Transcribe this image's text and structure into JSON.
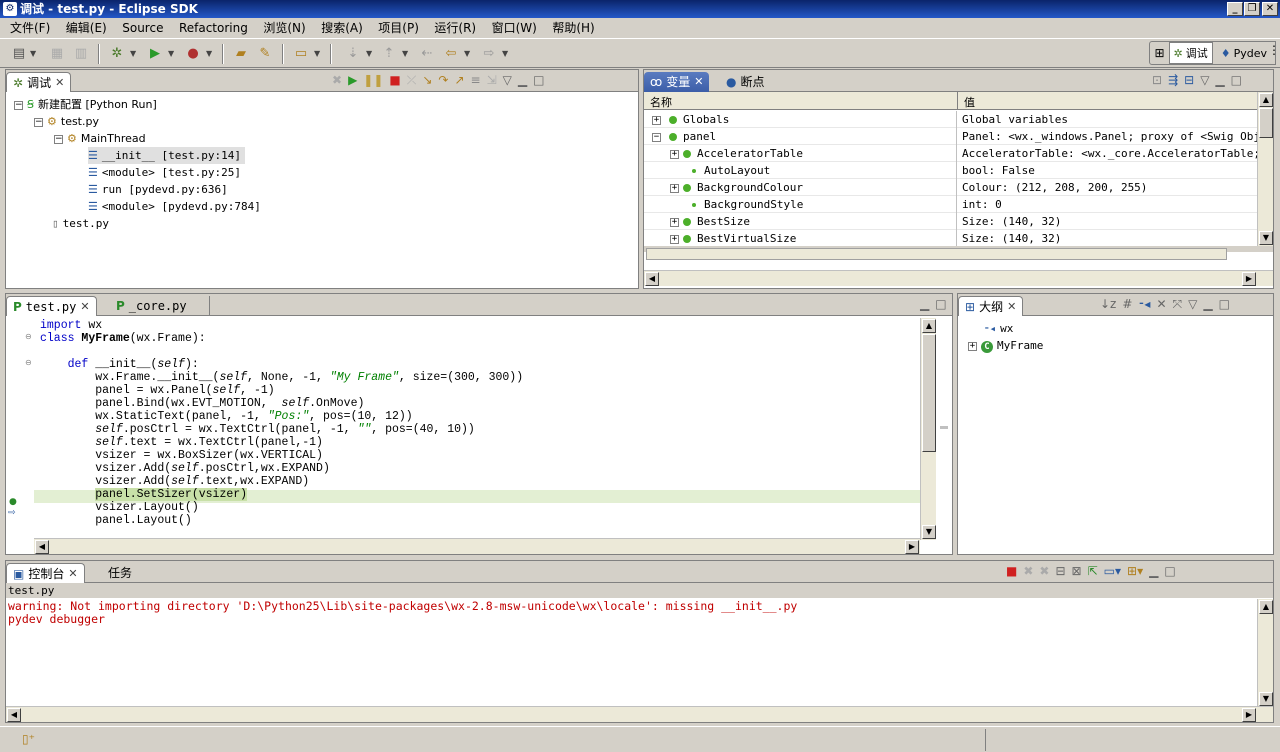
{
  "window": {
    "title": "调试 - test.py - Eclipse SDK"
  },
  "menu": [
    "文件(F)",
    "编辑(E)",
    "Source",
    "Refactoring",
    "浏览(N)",
    "搜索(A)",
    "项目(P)",
    "运行(R)",
    "窗口(W)",
    "帮助(H)"
  ],
  "perspectives": [
    {
      "label": "调试",
      "active": true
    },
    {
      "label": "Pydev",
      "active": false
    }
  ],
  "debug_view": {
    "tab": "调试",
    "tree": [
      {
        "label": "新建配置 [Python Run]",
        "level": 0
      },
      {
        "label": "test.py",
        "level": 1
      },
      {
        "label": "MainThread",
        "level": 2
      },
      {
        "label": "__init__ [test.py:14]",
        "level": 3,
        "selected": true
      },
      {
        "label": "<module> [test.py:25]",
        "level": 3
      },
      {
        "label": "run [pydevd.py:636]",
        "level": 3
      },
      {
        "label": "<module> [pydevd.py:784]",
        "level": 3
      },
      {
        "label": "test.py",
        "level": 1
      }
    ]
  },
  "variables_view": {
    "tabs": [
      "变量",
      "断点"
    ],
    "columns": [
      "名称",
      "值"
    ],
    "rows": [
      {
        "name": "Globals",
        "value": "Global variables",
        "level": 0,
        "expander": "+"
      },
      {
        "name": "panel",
        "value": "Panel: <wx._windows.Panel; proxy of <Swig Object.",
        "level": 0,
        "expander": "-"
      },
      {
        "name": "AcceleratorTable",
        "value": "AcceleratorTable: <wx._core.AcceleratorTable; pr.",
        "level": 1,
        "expander": "+"
      },
      {
        "name": "AutoLayout",
        "value": "bool: False",
        "level": 1,
        "expander": ""
      },
      {
        "name": "BackgroundColour",
        "value": "Colour: (212, 208, 200, 255)",
        "level": 1,
        "expander": "+"
      },
      {
        "name": "BackgroundStyle",
        "value": "int: 0",
        "level": 1,
        "expander": ""
      },
      {
        "name": "BestSize",
        "value": "Size: (140, 32)",
        "level": 1,
        "expander": "+"
      },
      {
        "name": "BestVirtualSize",
        "value": "Size: (140, 32)",
        "level": 1,
        "expander": "+"
      }
    ]
  },
  "editor": {
    "tabs": [
      "test.py",
      "_core.py"
    ],
    "lines": [
      {
        "t": "import",
        "r": " wx",
        "k": "kw"
      },
      {
        "t": "class",
        "r": " ",
        "b": "MyFrame",
        "r2": "(wx.Frame):",
        "k": "kw"
      },
      {
        "plain": ""
      },
      {
        "indent": "    ",
        "t": "def",
        "r": " __init__(",
        "s": "self",
        "r2": "):",
        "k": "kw"
      },
      {
        "plain": "        wx.Frame.__init__(",
        "s": "self",
        "r2": ", None, -1, ",
        "str": "\"My Frame\"",
        "r3": ", size=(300, 300))"
      },
      {
        "plain": "        panel = wx.Panel(",
        "s": "self",
        "r2": ", -1)"
      },
      {
        "plain": "        panel.Bind(wx.EVT_MOTION,  ",
        "s": "self",
        "r2": ".OnMove)"
      },
      {
        "plain": "        wx.StaticText(panel, -1, ",
        "str": "\"Pos:\"",
        "r3": ", pos=(10, 12))"
      },
      {
        "plain": "        ",
        "s": "self",
        "r2": ".posCtrl = wx.TextCtrl(panel, -1, ",
        "str": "\"\"",
        "r3": ", pos=(40, 10))"
      },
      {
        "plain": "        ",
        "s": "self",
        "r2": ".text = wx.TextCtrl(panel,-1)"
      },
      {
        "plain": "        vsizer = wx.BoxSizer(wx.VERTICAL)"
      },
      {
        "plain": "        vsizer.Add(",
        "s": "self",
        "r2": ".posCtrl,wx.EXPAND)"
      },
      {
        "plain": "        vsizer.Add(",
        "s": "self",
        "r2": ".text,wx.EXPAND)"
      },
      {
        "plain": "        ",
        "hl": "panel.SetSizer(vsizer)"
      },
      {
        "plain": "        vsizer.Layout()"
      },
      {
        "plain": "        panel.Layout()"
      }
    ]
  },
  "outline": {
    "tab": "大纲",
    "items": [
      {
        "label": "wx"
      },
      {
        "label": "MyFrame"
      }
    ]
  },
  "console": {
    "tabs": [
      "控制台",
      "任务"
    ],
    "title": "test.py",
    "lines": [
      "warning: Not importing directory 'D:\\Python25\\Lib\\site-packages\\wx-2.8-msw-unicode\\wx\\locale': missing __init__.py",
      "pydev debugger"
    ],
    "color": "#c00000"
  }
}
